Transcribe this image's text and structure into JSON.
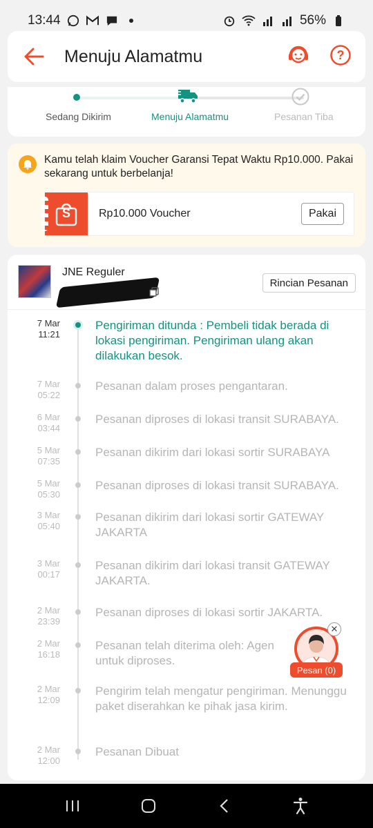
{
  "status_bar": {
    "time": "13:44",
    "battery": "56%"
  },
  "header": {
    "title": "Menuju Alamatmu",
    "icons": [
      "back-arrow-icon",
      "headset-icon",
      "help-icon"
    ],
    "accent": "#ee4d2d"
  },
  "progress": {
    "steps": [
      {
        "label": "Sedang Dikirim",
        "state": "done"
      },
      {
        "label": "Menuju Alamatmu",
        "state": "current"
      },
      {
        "label": "Pesanan Tiba",
        "state": "pending"
      }
    ],
    "accent": "#14927f"
  },
  "voucher": {
    "message": "Kamu telah klaim Voucher Garansi Tepat Waktu Rp10.000. Pakai sekarang untuk berbelanja!",
    "voucher_name": "Rp10.000 Voucher",
    "button_label": "Pakai",
    "logo_letter": "S"
  },
  "courier": {
    "name": "JNE Reguler",
    "details_button": "Rincian Pesanan"
  },
  "timeline": [
    {
      "date": "7 Mar",
      "time": "11:21",
      "text": "Pengiriman ditunda : Pembeli tidak berada di lokasi pengiriman. Pengiriman ulang akan dilakukan besok.",
      "active": true
    },
    {
      "date": "7 Mar",
      "time": "05:22",
      "text": "Pesanan dalam proses pengantaran."
    },
    {
      "date": "6 Mar",
      "time": "03:44",
      "text": "Pesanan diproses di lokasi transit  SURABAYA."
    },
    {
      "date": "5 Mar",
      "time": "07:35",
      "text": "Pesanan dikirim dari lokasi sortir  SURABAYA"
    },
    {
      "date": "5 Mar",
      "time": "05:30",
      "text": "Pesanan diproses di lokasi transit  SURABAYA."
    },
    {
      "date": "3 Mar",
      "time": "05:40",
      "text": "Pesanan dikirim dari lokasi sortir   GATEWAY JAKARTA"
    },
    {
      "date": "3 Mar",
      "time": "00:17",
      "text": "Pesanan dikirim dari lokasi transit  GATEWAY JAKARTA."
    },
    {
      "date": "2 Mar",
      "time": "23:39",
      "text": "Pesanan diproses di lokasi sortir  JAKARTA."
    },
    {
      "date": "2 Mar",
      "time": "16:18",
      "text": "Pesanan telah diterima oleh: Agen \nuntuk diproses."
    },
    {
      "date": "2 Mar",
      "time": "12:09",
      "text": "Pengirim telah mengatur pengiriman. Menunggu paket diserahkan ke pihak jasa kirim."
    },
    {
      "date": "2 Mar",
      "time": "12:00",
      "text": "Pesanan Dibuat"
    }
  ],
  "chat": {
    "label": "Pesan (0)",
    "close": "✕"
  },
  "nav_bar": {
    "icons": [
      "recent-apps-icon",
      "home-icon",
      "back-icon",
      "accessibility-icon"
    ]
  }
}
